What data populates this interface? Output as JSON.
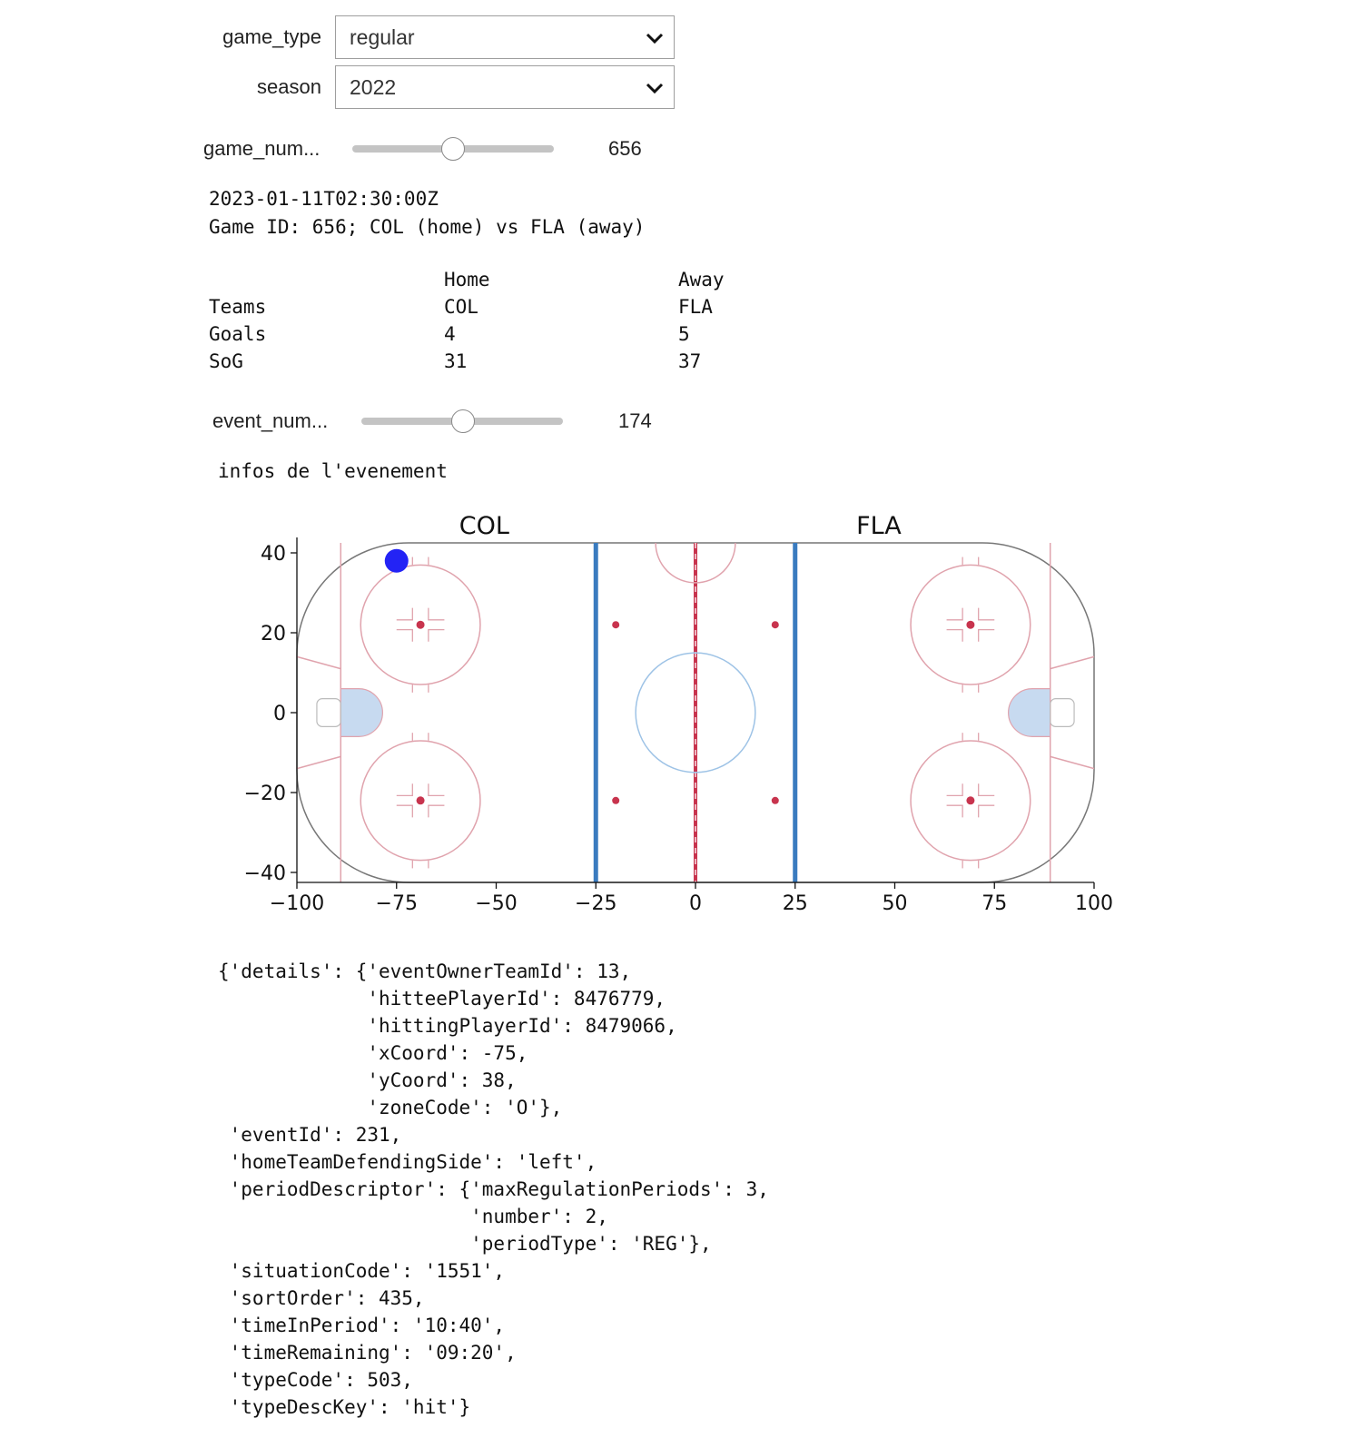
{
  "controls": {
    "game_type": {
      "label": "game_type",
      "value": "regular"
    },
    "season": {
      "label": "season",
      "value": "2022"
    },
    "game_number": {
      "label": "game_num...",
      "value": "656",
      "position": 0.5
    },
    "event_number": {
      "label": "event_num...",
      "value": "174",
      "position": 0.5
    }
  },
  "game_info": {
    "datetime": "2023-01-11T02:30:00Z",
    "summary": "Game ID: 656; COL (home) vs FLA (away)"
  },
  "stats_table": {
    "headers": [
      "",
      "Home",
      "Away"
    ],
    "rows": [
      [
        "Teams",
        "COL",
        "FLA"
      ],
      [
        "Goals",
        "4",
        "5"
      ],
      [
        "SoG",
        "31",
        "37"
      ]
    ]
  },
  "event_header": "infos de l'evenement",
  "chart_data": {
    "type": "scatter",
    "title_left": "COL",
    "title_right": "FLA",
    "xlim": [
      -100,
      100
    ],
    "ylim": [
      -42.5,
      42.5
    ],
    "x_ticks": [
      -100,
      -75,
      -50,
      -25,
      0,
      25,
      50,
      75,
      100
    ],
    "x_tick_labels": [
      "−100",
      "−75",
      "−50",
      "−25",
      "0",
      "25",
      "50",
      "75",
      "100"
    ],
    "y_ticks": [
      40,
      20,
      0,
      -20,
      -40
    ],
    "y_tick_labels": [
      "40",
      "20",
      "0",
      "−20",
      "−40"
    ],
    "points": [
      {
        "x": -75,
        "y": 38,
        "color": "#2323f5"
      }
    ],
    "background": "hockey rink"
  },
  "event_details": [
    "{'details': {'eventOwnerTeamId': 13,",
    "             'hitteePlayerId': 8476779,",
    "             'hittingPlayerId': 8479066,",
    "             'xCoord': -75,",
    "             'yCoord': 38,",
    "             'zoneCode': 'O'},",
    " 'eventId': 231,",
    " 'homeTeamDefendingSide': 'left',",
    " 'periodDescriptor': {'maxRegulationPeriods': 3,",
    "                      'number': 2,",
    "                      'periodType': 'REG'},",
    " 'situationCode': '1551',",
    " 'sortOrder': 435,",
    " 'timeInPeriod': '10:40',",
    " 'timeRemaining': '09:20',",
    " 'typeCode': 503,",
    " 'typeDescKey': 'hit'}"
  ],
  "colors": {
    "blue_line": "#3a7bbf",
    "red_line": "#c8344e",
    "faceoff_circle": "#e0a3ad",
    "center_circle": "#9ec3e6",
    "crease": "#c7daf0",
    "point": "#2323f5"
  }
}
